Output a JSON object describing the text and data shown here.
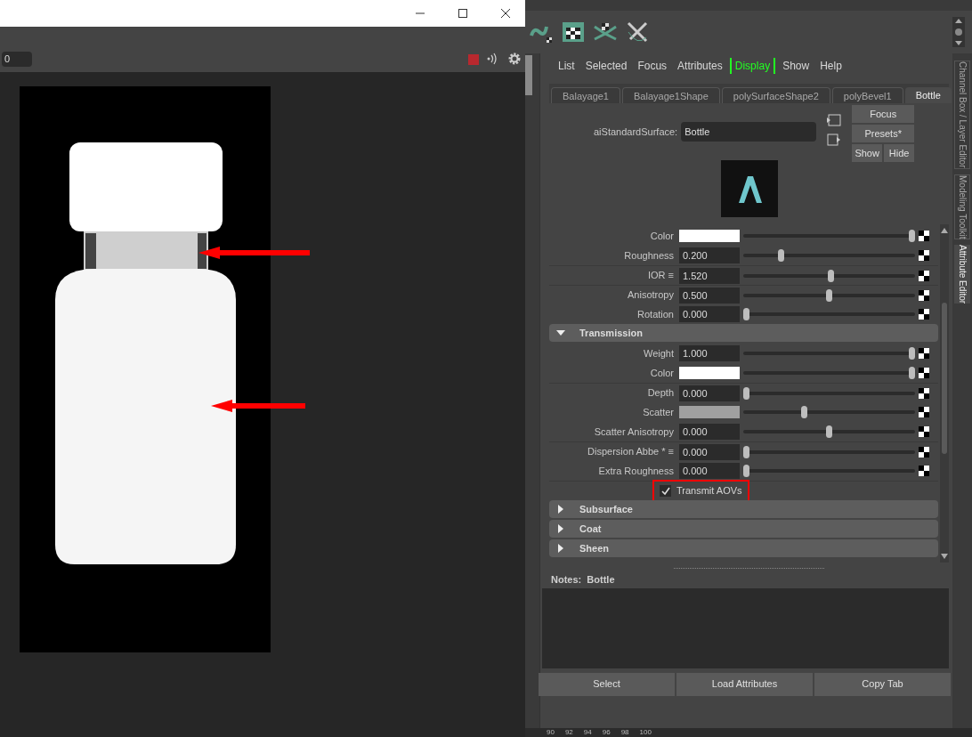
{
  "render_window": {
    "frame_field": "0"
  },
  "menu": [
    {
      "label": "List",
      "highlighted": false
    },
    {
      "label": "Selected",
      "highlighted": false
    },
    {
      "label": "Focus",
      "highlighted": false
    },
    {
      "label": "Attributes",
      "highlighted": false
    },
    {
      "label": "Display",
      "highlighted": true
    },
    {
      "label": "Show",
      "highlighted": false
    },
    {
      "label": "Help",
      "highlighted": false
    }
  ],
  "tabs": [
    {
      "label": "Balayage1",
      "selected": false
    },
    {
      "label": "Balayage1Shape",
      "selected": false
    },
    {
      "label": "polySurfaceShape2",
      "selected": false
    },
    {
      "label": "polyBevel1",
      "selected": false
    },
    {
      "label": "Bottle",
      "selected": true
    }
  ],
  "node": {
    "type_label": "aiStandardSurface:",
    "name": "Bottle"
  },
  "node_buttons": [
    "Focus",
    "Presets*",
    "Show",
    "Hide"
  ],
  "rows": [
    {
      "kind": "color",
      "label": "Color",
      "color": "#ffffff",
      "level": 1
    },
    {
      "kind": "number",
      "label": "Roughness",
      "value": "0.200",
      "level": 0.21
    },
    {
      "kind": "number",
      "label": "IOR ≡",
      "value": "1.520",
      "level": 0.51,
      "divider": true
    },
    {
      "kind": "number",
      "label": "Anisotropy",
      "value": "0.500",
      "level": 0.5,
      "divider": true
    },
    {
      "kind": "number",
      "label": "Rotation",
      "value": "0.000",
      "level": 0
    }
  ],
  "sections": [
    {
      "title": "Transmission",
      "expanded": true,
      "rows": [
        {
          "kind": "number",
          "label": "Weight",
          "value": "1.000",
          "level": 1
        },
        {
          "kind": "color",
          "label": "Color",
          "color": "#ffffff",
          "level": 1
        },
        {
          "kind": "number",
          "label": "Depth",
          "value": "0.000",
          "level": 0,
          "divider": true
        },
        {
          "kind": "color",
          "label": "Scatter",
          "color": "#a0a0a0",
          "level": 0.35
        },
        {
          "kind": "number",
          "label": "Scatter Anisotropy",
          "value": "0.000",
          "level": 0.5
        },
        {
          "kind": "number",
          "label": "Dispersion Abbe * ≡",
          "value": "0.000",
          "level": 0,
          "divider": true
        },
        {
          "kind": "number",
          "label": "Extra Roughness",
          "value": "0.000",
          "level": 0
        },
        {
          "kind": "checkbox",
          "label": "Transmit AOVs",
          "checked": true,
          "highlighted": true,
          "divider": true
        }
      ]
    },
    {
      "title": "Subsurface",
      "expanded": false
    },
    {
      "title": "Coat",
      "expanded": false
    },
    {
      "title": "Sheen",
      "expanded": false
    }
  ],
  "notes": {
    "label": "Notes:  Bottle"
  },
  "bottom_buttons": [
    "Select",
    "Load Attributes",
    "Copy Tab"
  ],
  "side_tabs": [
    {
      "label": "Channel Box / Layer Editor",
      "selected": false
    },
    {
      "label": "Modeling Toolkit",
      "selected": false
    },
    {
      "label": "Attribute Editor",
      "selected": true
    }
  ],
  "timeline": [
    "90",
    "92",
    "94",
    "96",
    "98",
    "100"
  ]
}
